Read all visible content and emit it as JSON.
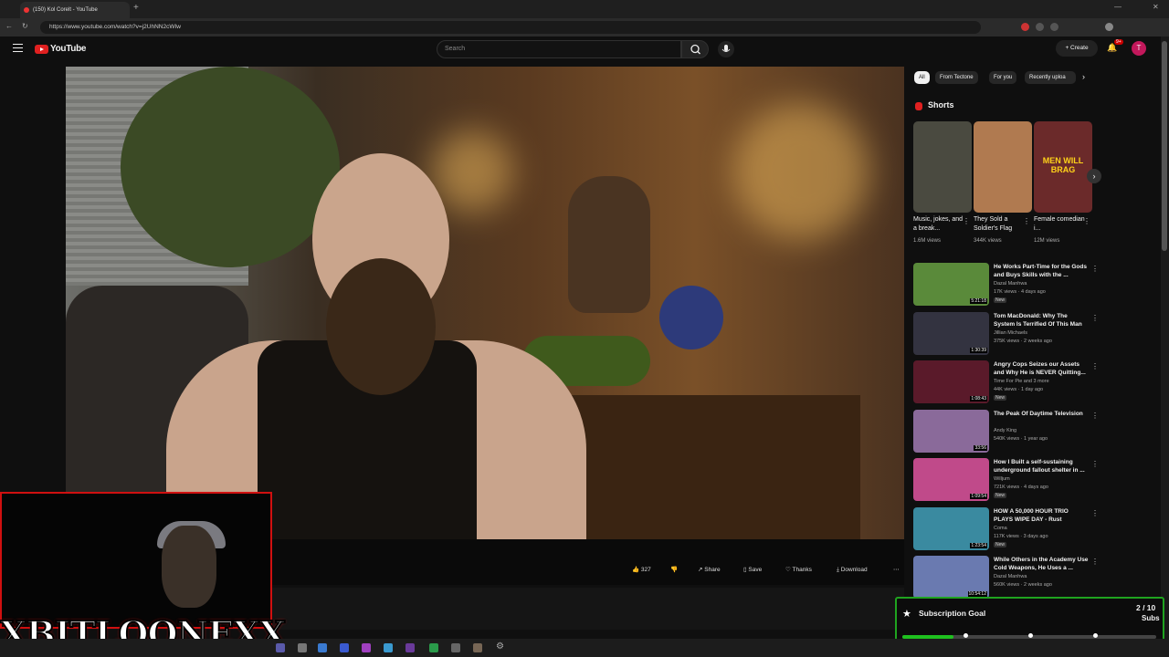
{
  "browser": {
    "tab_title": "(150) Kol Corelt - YouTube",
    "url": "https://www.youtube.com/watch?v=j2UhNN2cWIw"
  },
  "youtube": {
    "logo_text": "YouTube",
    "search_placeholder": "Search",
    "create_label": "Create",
    "notification_badge": "9+",
    "avatar_initial": "T"
  },
  "actions": {
    "like_count": "327",
    "share": "Share",
    "save": "Save",
    "thanks": "Thanks",
    "download": "Download"
  },
  "chips": [
    "All",
    "From Tectone",
    "For you",
    "Recently uploa"
  ],
  "shorts": {
    "heading": "Shorts",
    "items": [
      {
        "title": "Music, jokes, and a break...",
        "views": "1.6M views",
        "color": "#4a4a40"
      },
      {
        "title": "They Sold a Soldier's Flag",
        "views": "344K views",
        "color": "#b07a50"
      },
      {
        "title": "Female comedian i...",
        "views": "12M views",
        "color": "#6b2a2a",
        "overlay": "MEN WILL BRAG"
      }
    ]
  },
  "recommendations": [
    {
      "title": "He Works Part-Time for the Gods and Buys Skills with the ...",
      "channel": "Dazal Manhwa",
      "meta": "17K views · 4 days ago",
      "duration": "5:21:18",
      "new": "New",
      "color": "#5a8a3a"
    },
    {
      "title": "Tom MacDonald: Why The System Is Terrified Of This Man",
      "channel": "Jillian Michaels",
      "meta": "375K views · 2 weeks ago",
      "duration": "1:30:39",
      "new": "",
      "color": "#333340"
    },
    {
      "title": "Angry Cops Seizes our Assets and Why He is NEVER Quitting...",
      "channel": "Time For Pie and 3 more",
      "meta": "44K views · 1 day ago",
      "duration": "1:08:43",
      "new": "New",
      "color": "#5a1a2a"
    },
    {
      "title": "The Peak Of Daytime Television",
      "channel": "Andy King",
      "meta": "540K views · 1 year ago",
      "duration": "33:56",
      "new": "",
      "color": "#8a6a9a"
    },
    {
      "title": "How I Built a self-sustaining underground fallout shelter in ...",
      "channel": "Willjum",
      "meta": "721K views · 4 days ago",
      "duration": "1:09:54",
      "new": "New",
      "color": "#c04a8a"
    },
    {
      "title": "HOW A 50,000 HOUR TRIO PLAYS WIPE DAY - Rust",
      "channel": "Coma",
      "meta": "117K views · 3 days ago",
      "duration": "1:23:54",
      "new": "New",
      "color": "#3a8aa0"
    },
    {
      "title": "While Others in the Academy Use Cold Weapons, He Uses a ...",
      "channel": "Dazal Manhwa",
      "meta": "560K views · 2 weeks ago",
      "duration": "10:54:12",
      "new": "",
      "color": "#6a7ab0"
    }
  ],
  "overlay": {
    "streamer_name": "XBITLOONEXX",
    "goal_title": "Subscription Goal",
    "goal_count": "2 / 10",
    "goal_unit": "Subs",
    "goal_progress": 0.2
  }
}
